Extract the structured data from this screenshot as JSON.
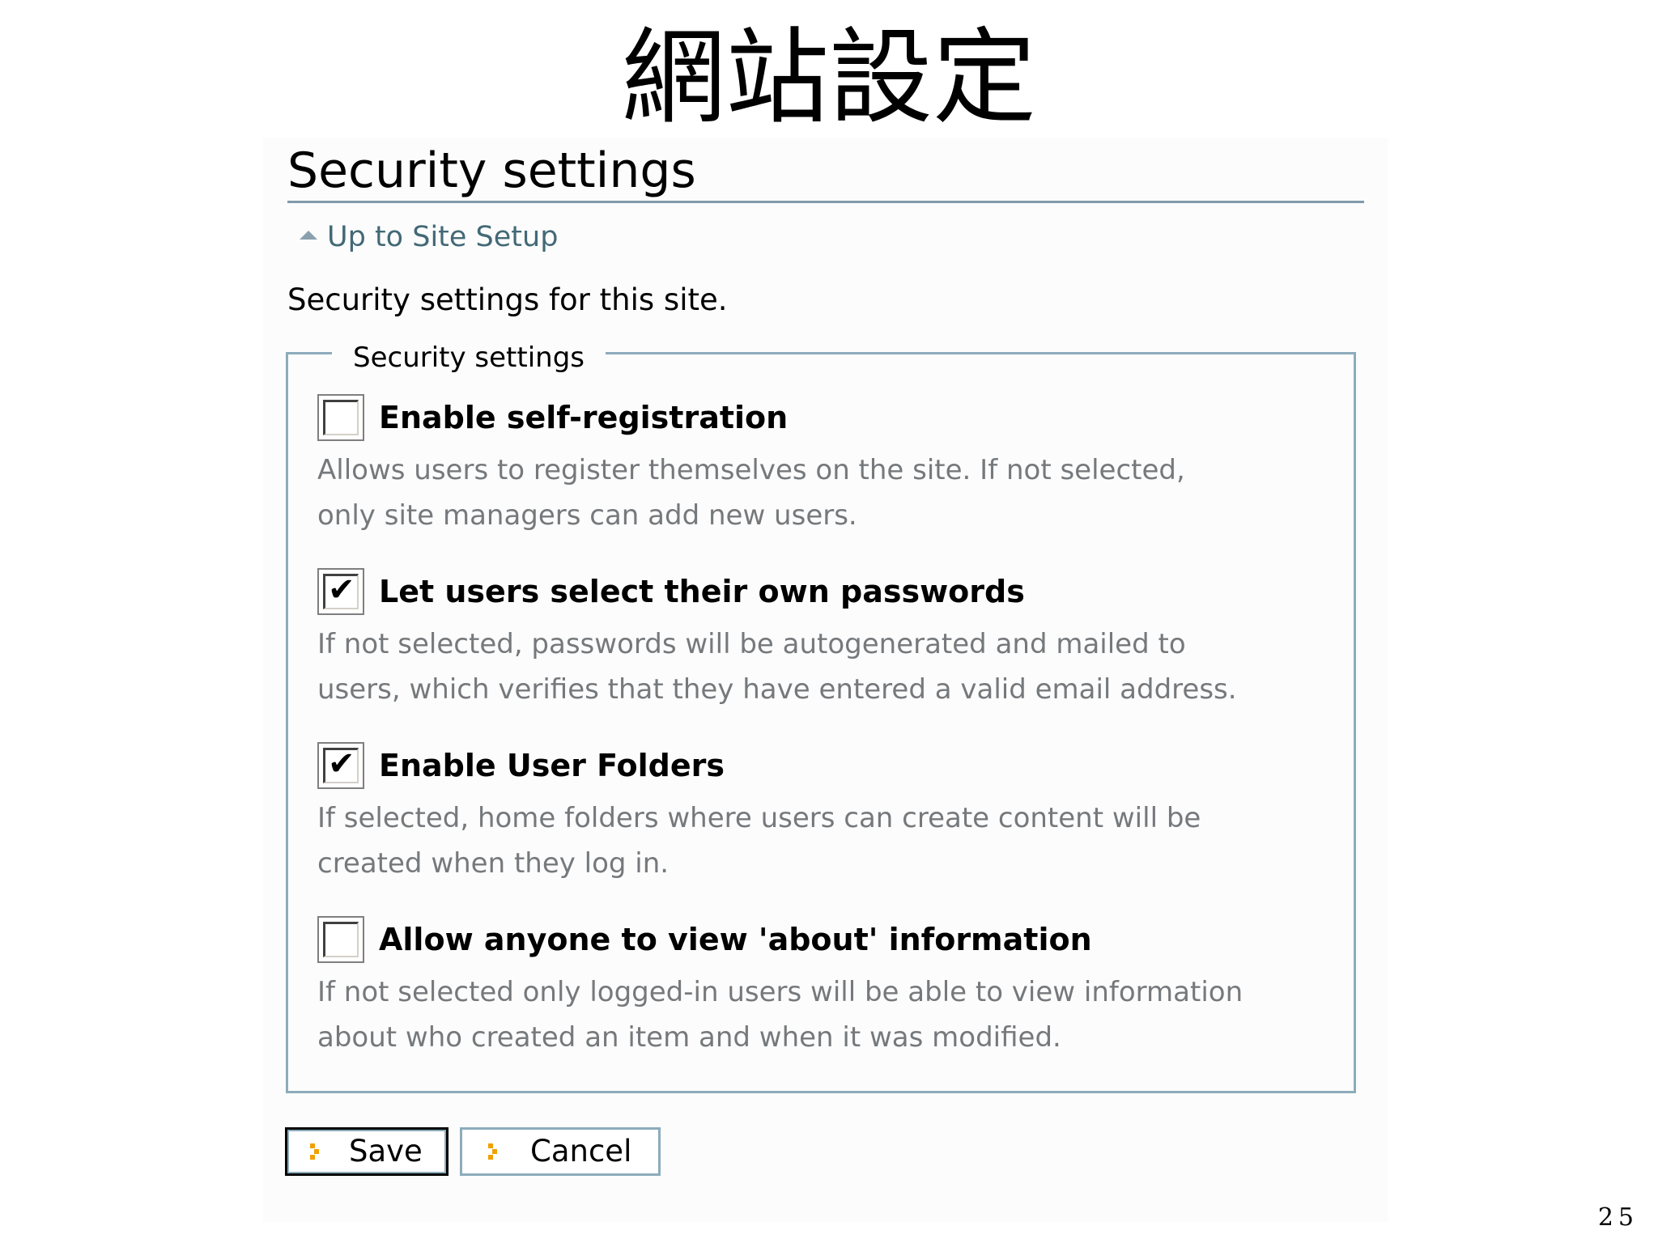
{
  "slide": {
    "title": "網站設定",
    "page_number": "25"
  },
  "page": {
    "heading": "Security settings",
    "up_link": "Up to Site Setup",
    "description": "Security settings for this site."
  },
  "fieldset": {
    "legend": "Security settings",
    "options": [
      {
        "label": "Enable self-registration",
        "checked": false,
        "help": [
          "Allows users to register themselves on the site. If not selected,",
          "only site managers can add new users."
        ]
      },
      {
        "label": "Let users select their own passwords",
        "checked": true,
        "help": [
          "If not selected, passwords will be autogenerated and mailed to",
          "users, which verifies that they have entered a valid email address."
        ]
      },
      {
        "label": "Enable User Folders",
        "checked": true,
        "help": [
          "If selected, home folders where users can create content will be",
          "created when they log in."
        ]
      },
      {
        "label": "Allow anyone to view 'about' information",
        "checked": false,
        "help": [
          "If not selected only logged-in users will be able to view information",
          "about who created an item and when it was modified."
        ]
      }
    ]
  },
  "buttons": {
    "save": "Save",
    "cancel": "Cancel"
  },
  "colors": {
    "link": "#436976",
    "border": "#8cacbb",
    "help_text": "#76797c",
    "button_arrow": "#f0a000"
  },
  "icons": {
    "checkmark": "✔",
    "up_arrow": "up-arrow-icon",
    "button_arrow": "arrow-right-icon"
  }
}
